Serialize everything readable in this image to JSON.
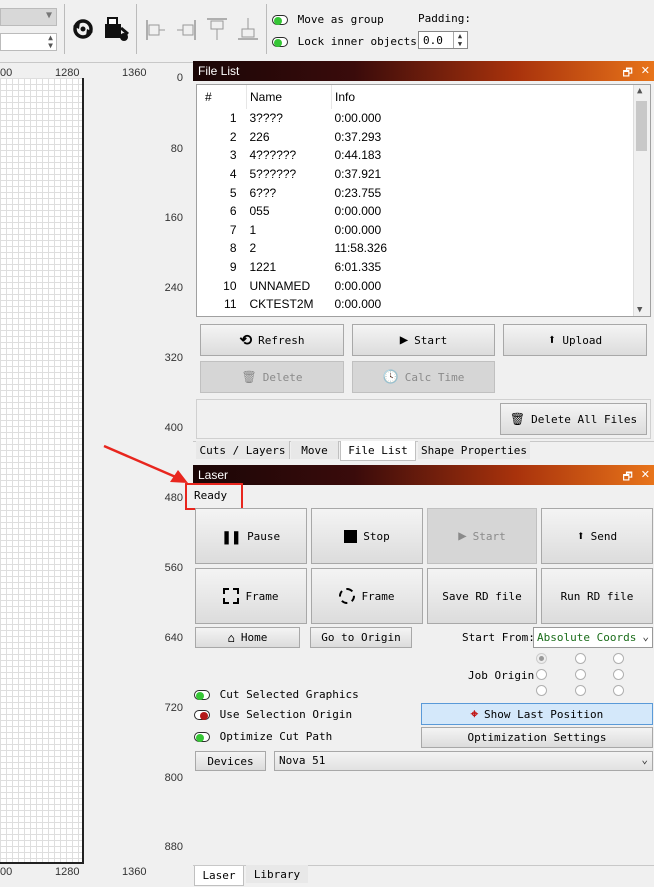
{
  "toolbar": {
    "move_as_group": "Move as group",
    "lock_inner_objects": "Lock inner objects",
    "padding_label": "Padding:",
    "padding_value": "0.0"
  },
  "ruler": {
    "top_labels": [
      "00",
      "1280",
      "1360"
    ],
    "bottom_labels": [
      "00",
      "1280",
      "1360"
    ],
    "left_labels": [
      "0",
      "80",
      "160",
      "240",
      "320",
      "400",
      "480",
      "560",
      "640",
      "720",
      "800",
      "880"
    ]
  },
  "file_list": {
    "title": "File List",
    "columns": [
      "#",
      "Name",
      "Info"
    ],
    "rows": [
      {
        "num": "1",
        "name": "3????",
        "info": "0:00.000"
      },
      {
        "num": "2",
        "name": "226",
        "info": "0:37.293"
      },
      {
        "num": "3",
        "name": "4??????",
        "info": "0:44.183"
      },
      {
        "num": "4",
        "name": "5??????",
        "info": "0:37.921"
      },
      {
        "num": "5",
        "name": "6???",
        "info": "0:23.755"
      },
      {
        "num": "6",
        "name": "055",
        "info": "0:00.000"
      },
      {
        "num": "7",
        "name": "1",
        "info": "0:00.000"
      },
      {
        "num": "8",
        "name": "2",
        "info": "11:58.326"
      },
      {
        "num": "9",
        "name": "1221",
        "info": "6:01.335"
      },
      {
        "num": "10",
        "name": "UNNAMED",
        "info": "0:00.000"
      },
      {
        "num": "11",
        "name": "CKTEST2M",
        "info": "0:00.000"
      }
    ],
    "refresh": "Refresh",
    "start": "Start",
    "upload": "Upload",
    "delete": "Delete",
    "calc_time": "Calc Time",
    "delete_all": "Delete All Files"
  },
  "tabs_top": [
    "Cuts / Layers",
    "Move",
    "File List",
    "Shape Properties"
  ],
  "laser": {
    "title": "Laser",
    "status": "Ready",
    "pause": "Pause",
    "stop": "Stop",
    "start": "Start",
    "send": "Send",
    "frame1": "Frame",
    "frame2": "Frame",
    "save_rd": "Save RD file",
    "run_rd": "Run RD file",
    "home": "Home",
    "go_to_origin": "Go to Origin",
    "start_from_label": "Start From:",
    "start_from_value": "Absolute Coords",
    "job_origin": "Job Origin",
    "cut_selected": "Cut Selected Graphics",
    "use_selection_origin": "Use Selection Origin",
    "optimize_cut_path": "Optimize Cut Path",
    "show_last_position": "Show Last Position",
    "optimization_settings": "Optimization Settings",
    "devices": "Devices",
    "device_value": "Nova 51"
  },
  "tabs_bottom": [
    "Laser",
    "Library"
  ],
  "colors": {
    "highlight_red": "#e8261e",
    "toggle_on": "#36c636",
    "toggle_off": "#b41818"
  }
}
